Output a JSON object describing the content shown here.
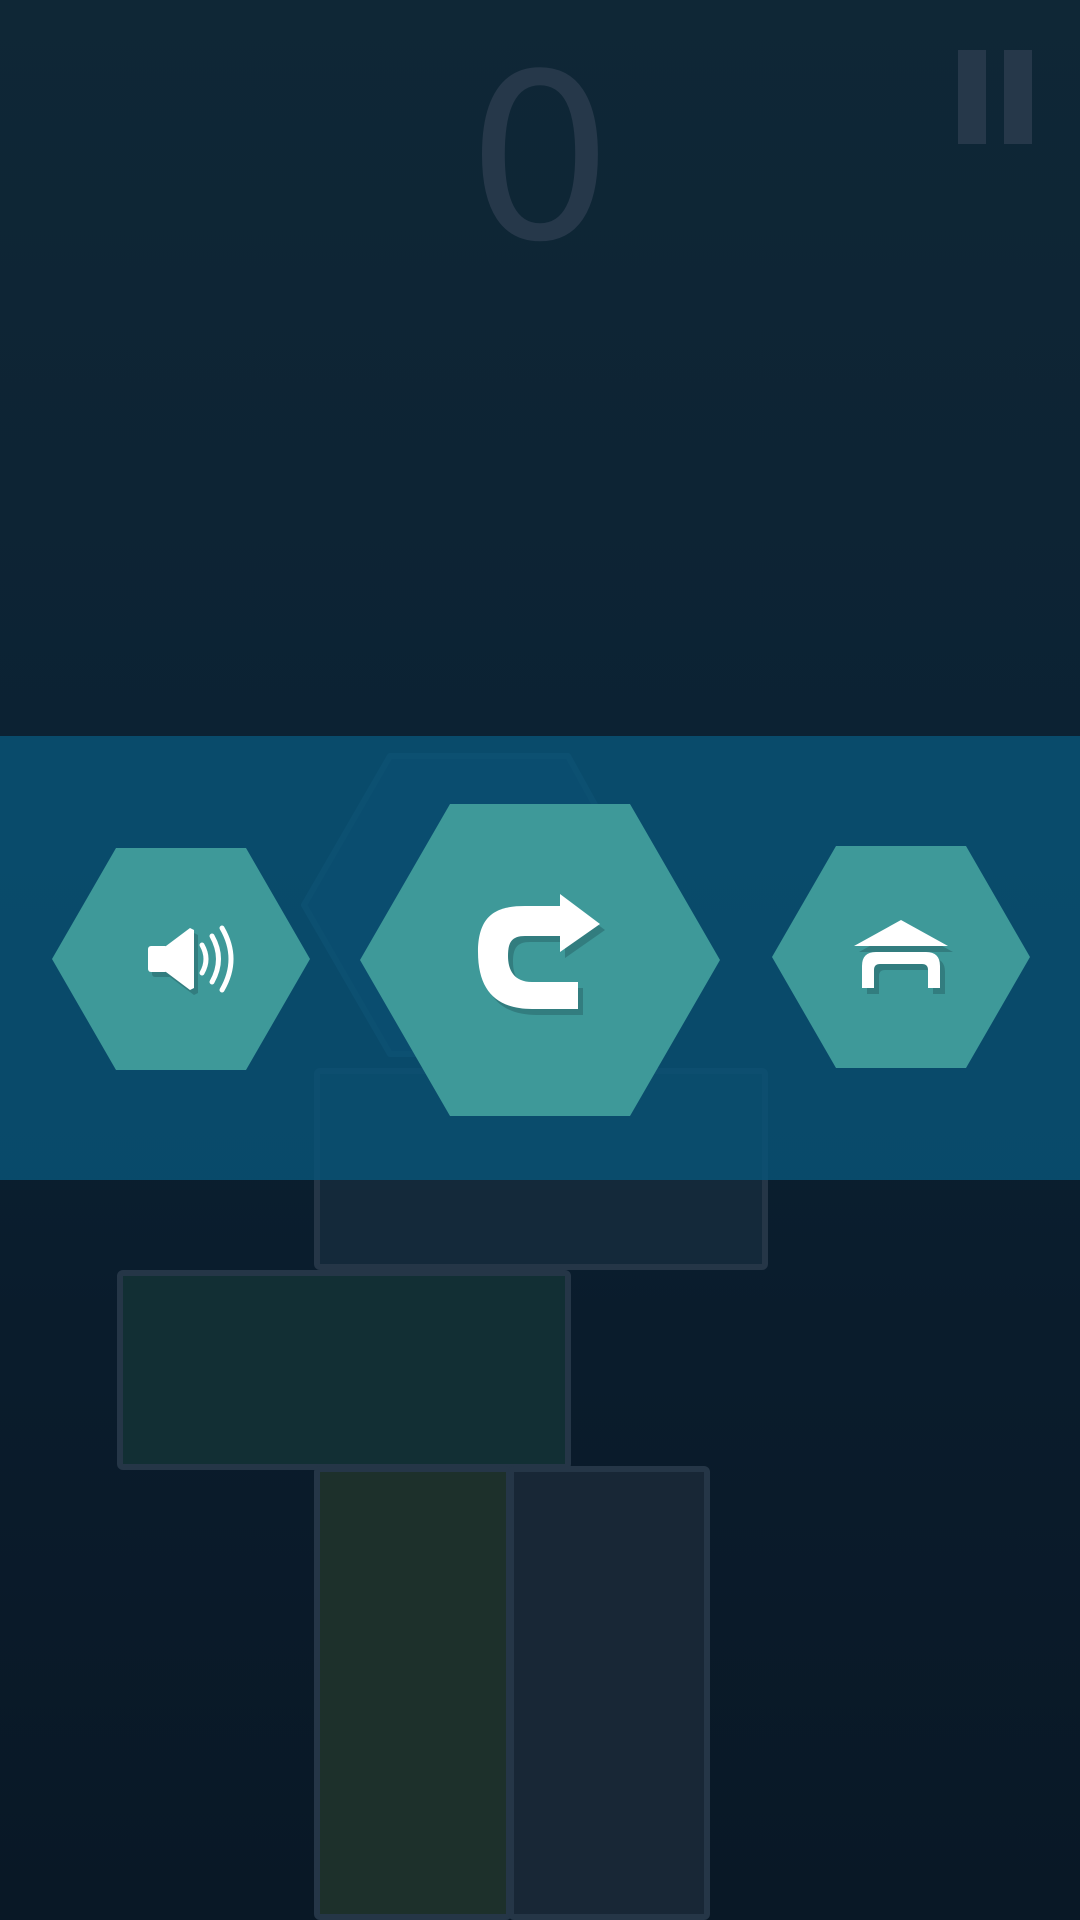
{
  "game": {
    "score": "0"
  },
  "menu": {
    "buttons": [
      {
        "name": "sound",
        "icon": "speaker-icon"
      },
      {
        "name": "restart",
        "icon": "restart-arrow-icon"
      },
      {
        "name": "home",
        "icon": "home-icon"
      }
    ]
  },
  "colors": {
    "background": "#0c2233",
    "band": "#085478",
    "hex_button": "#3e9999",
    "icon": "#ffffff",
    "muted": "#26384a",
    "block_green_dark": "#122f34",
    "block_green_olive": "#1d302b",
    "block_slate": "#182736",
    "block_outline": "#253647"
  }
}
